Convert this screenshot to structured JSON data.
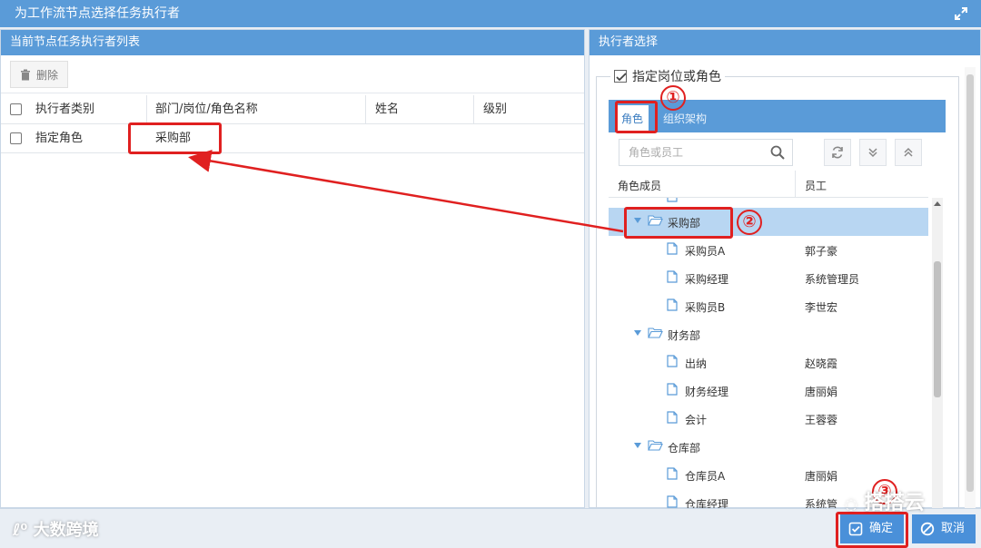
{
  "window": {
    "title": "为工作流节点选择任务执行者"
  },
  "left_panel": {
    "header": "当前节点任务执行者列表",
    "delete_label": "删除",
    "columns": [
      "执行者类别",
      "部门/岗位/角色名称",
      "姓名",
      "级别"
    ],
    "rows": [
      {
        "type": "指定角色",
        "name": "采购部",
        "person": "",
        "level": ""
      }
    ]
  },
  "right_panel": {
    "header": "执行者选择",
    "legend": "指定岗位或角色",
    "tabs": [
      {
        "label": "角色"
      },
      {
        "label": "组织架构"
      }
    ],
    "search_placeholder": "角色或员工",
    "tree_columns": [
      "角色成员",
      "员工"
    ],
    "tree": [
      {
        "label": "采购部",
        "kind": "folder",
        "selected": true,
        "employee": ""
      },
      {
        "label": "采购员A",
        "kind": "file",
        "employee": "郭子豪"
      },
      {
        "label": "采购经理",
        "kind": "file",
        "employee": "系统管理员"
      },
      {
        "label": "采购员B",
        "kind": "file",
        "employee": "李世宏"
      },
      {
        "label": "财务部",
        "kind": "folder",
        "employee": ""
      },
      {
        "label": "出纳",
        "kind": "file",
        "employee": "赵晓霞"
      },
      {
        "label": "财务经理",
        "kind": "file",
        "employee": "唐丽娟"
      },
      {
        "label": "会计",
        "kind": "file",
        "employee": "王蓉蓉"
      },
      {
        "label": "仓库部",
        "kind": "folder",
        "employee": ""
      },
      {
        "label": "仓库员A",
        "kind": "file",
        "employee": "唐丽娟"
      },
      {
        "label": "仓库经理",
        "kind": "file",
        "employee": "系统管"
      }
    ]
  },
  "footer": {
    "ok_label": "确定",
    "cancel_label": "取消"
  },
  "annotations": {
    "step1": "①",
    "step2": "②",
    "step3": "③"
  },
  "watermarks": {
    "left": "大数跨境",
    "right": "搭搭云"
  },
  "colors": {
    "accent": "#5a9bd8",
    "highlight": "#e02020",
    "selected_row": "#b8d6f2"
  }
}
